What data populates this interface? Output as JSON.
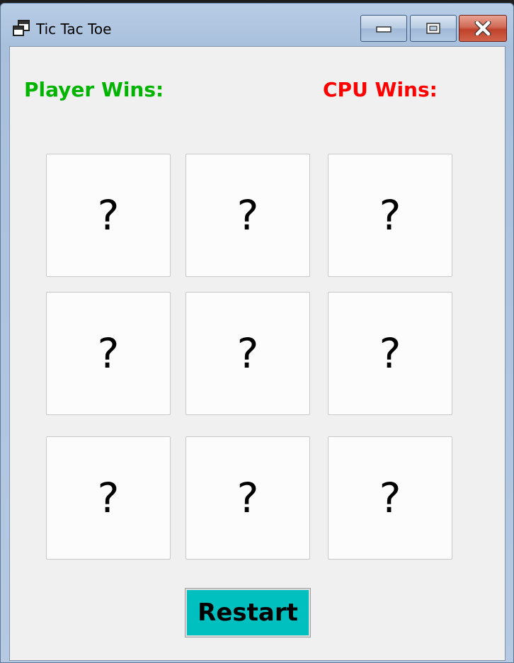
{
  "window": {
    "title": "Tic Tac Toe",
    "icon": "app-window-icon",
    "controls": {
      "minimize_icon": "minimize-icon",
      "maximize_icon": "maximize-icon",
      "close_icon": "close-icon"
    }
  },
  "scores": {
    "player_label": "Player Wins:",
    "player_color": "#00b400",
    "cpu_label": "CPU Wins:",
    "cpu_color": "#ff0000"
  },
  "board": {
    "cells": [
      {
        "label": "?"
      },
      {
        "label": "?"
      },
      {
        "label": "?"
      },
      {
        "label": "?"
      },
      {
        "label": "?"
      },
      {
        "label": "?"
      },
      {
        "label": "?"
      },
      {
        "label": "?"
      },
      {
        "label": "?"
      }
    ]
  },
  "restart": {
    "label": "Restart",
    "color": "#00bfbf"
  }
}
